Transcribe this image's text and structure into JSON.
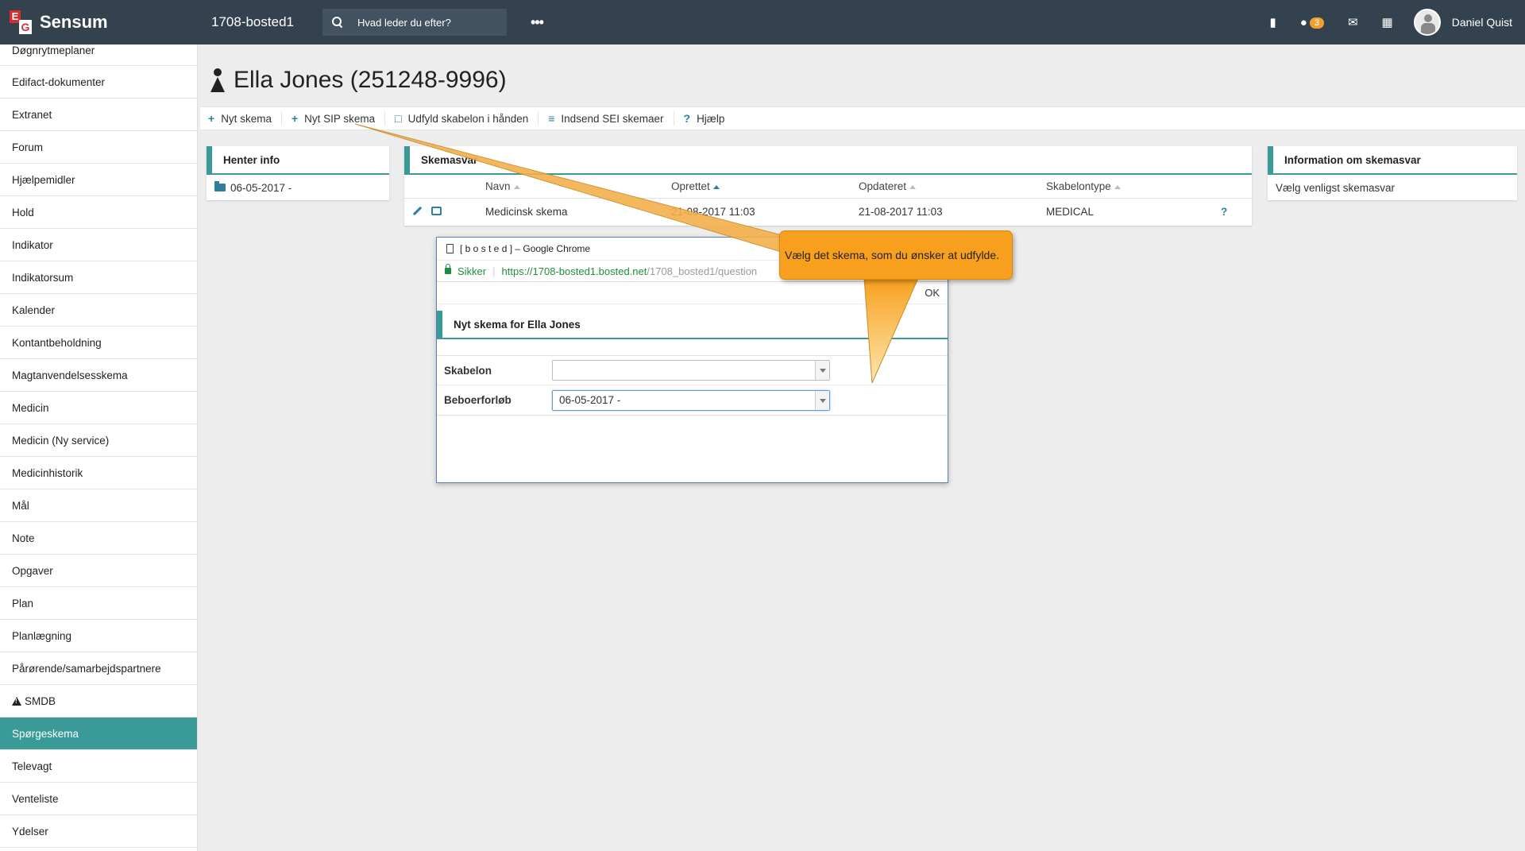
{
  "topbar": {
    "logo_e": "E",
    "logo_g": "G",
    "brand": "Sensum",
    "site": "1708-bosted1",
    "search_placeholder": "Hvad leder du efter?",
    "more": "•••",
    "messages_count": "3",
    "user": "Daniel Quist"
  },
  "sidebar": {
    "items": [
      "Døgnrytmeplaner",
      "Edifact-dokumenter",
      "Extranet",
      "Forum",
      "Hjælpemidler",
      "Hold",
      "Indikator",
      "Indikatorsum",
      "Kalender",
      "Kontantbeholdning",
      "Magtanvendelsesskema",
      "Medicin",
      "Medicin (Ny service)",
      "Medicinhistorik",
      "Mål",
      "Note",
      "Opgaver",
      "Plan",
      "Planlægning",
      "Pårørende/samarbejdspartnere",
      "SMDB",
      "Spørgeskema",
      "Televagt",
      "Venteliste",
      "Ydelser"
    ],
    "active": "Spørgeskema"
  },
  "page": {
    "title": "Ella Jones (251248-9996)"
  },
  "toolbar": {
    "new_form": "Nyt skema",
    "new_sip": "Nyt SIP skema",
    "fill_by_hand": "Udfyld skabelon i hånden",
    "send_sei": "Indsend SEI skemaer",
    "help": "Hjælp"
  },
  "left_panel": {
    "title": "Henter info",
    "row": "06-05-2017 -"
  },
  "center_panel": {
    "title": "Skemasvar",
    "columns": [
      "Navn",
      "Oprettet",
      "Opdateret",
      "Skabelontype"
    ],
    "rows": [
      {
        "navn": "Medicinsk skema",
        "oprettet": "21-08-2017 11:03",
        "opdateret": "21-08-2017 11:03",
        "type": "MEDICAL",
        "help": "?"
      }
    ]
  },
  "right_panel": {
    "title": "Information om skemasvar",
    "row": "Vælg venligst skemasvar"
  },
  "popup": {
    "window_title": "[ b o s t e d ] – Google Chrome",
    "secure": "Sikker",
    "url_main": "https://1708-bosted1.bosted.net",
    "url_rest": "/1708_bosted1/question",
    "close": "✖",
    "ok": "OK",
    "heading": "Nyt skema for Ella Jones",
    "fields": {
      "template_label": "Skabelon",
      "template_value": "",
      "course_label": "Beboerforløb",
      "course_value": "06-05-2017 -"
    }
  },
  "callout": {
    "text": "Vælg det skema, som du ønsker at udfylde.",
    "color": "#f8a01e"
  },
  "colors": {
    "topbar": "#34424f",
    "accent": "#3a9a98",
    "link": "#2f7e9e"
  }
}
